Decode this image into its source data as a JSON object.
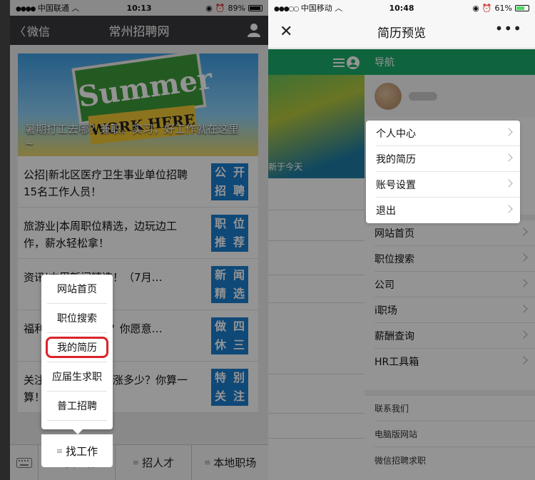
{
  "left": {
    "status": {
      "carrier": "中国联通",
      "time": "10:13",
      "battery": "89%"
    },
    "nav": {
      "back_label": "微信",
      "title": "常州招聘网"
    },
    "banner": {
      "sign_text": "Summer",
      "sign2_text": "WORK HERE",
      "caption": "暑期打工去哪？兼职、实习，好工作就在这里~"
    },
    "rows": [
      {
        "title": "公招|新北区医疗卫生事业单位招聘15名工作人员！",
        "tag": [
          "公",
          "开",
          "招",
          "聘"
        ]
      },
      {
        "title": "旅游业|本周职位精选，边玩边工作，薪水轻松拿！",
        "tag": [
          "职",
          "位",
          "推",
          "荐"
        ]
      },
      {
        "title": "资讯|本周新闻精选！（7月…",
        "tag": [
          "新",
          "闻",
          "精",
          "选"
        ]
      },
      {
        "title": "福利|上班，休3天？你愿意…",
        "tag": [
          "做",
          "四",
          "休",
          "三"
        ]
      },
      {
        "title": "关注|又涨了！到底涨多少？你算一算！",
        "tag": [
          "特",
          "别",
          "关",
          "注"
        ]
      }
    ],
    "popup_items": [
      "网站首页",
      "职位搜索",
      "我的简历",
      "应届生求职",
      "普工招聘"
    ],
    "tabs": [
      "找工作",
      "招人才",
      "本地职场"
    ]
  },
  "right": {
    "status": {
      "carrier": "中国移动",
      "time": "10:48",
      "battery": "61%"
    },
    "nav": {
      "title": "简历预览"
    },
    "page_caption": "新于今天",
    "drawer_title": "导航",
    "dropdown": [
      "个人中心",
      "我的简历",
      "账号设置",
      "退出"
    ],
    "menu": [
      "网站首页",
      "职位搜索",
      "公司",
      "i职场",
      "薪酬查询",
      "HR工具箱"
    ],
    "footer": [
      "联系我们",
      "电脑版网站",
      "微信招聘求职"
    ]
  }
}
